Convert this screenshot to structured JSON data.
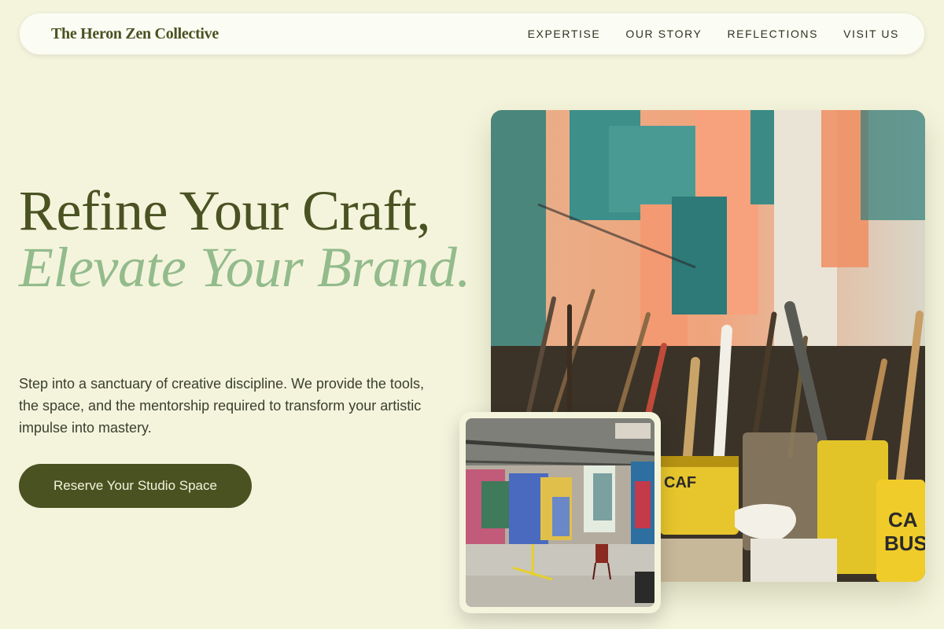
{
  "header": {
    "brand": "The Heron Zen Collective",
    "nav": [
      {
        "label": "EXPERTISE"
      },
      {
        "label": "OUR STORY"
      },
      {
        "label": "REFLECTIONS"
      },
      {
        "label": "VISIT US"
      }
    ]
  },
  "hero": {
    "title_line1": "Refine Your Craft,",
    "title_line2": "Elevate Your Brand.",
    "description": "Step into a sanctuary of creative discipline. We provide the tools, the space, and the mentorship required to transform your artistic impulse into mastery.",
    "cta_label": "Reserve Your Studio Space"
  },
  "images": {
    "main": "paint-brushes-in-cans-photo",
    "inset": "graffiti-art-studio-photo"
  },
  "colors": {
    "background": "#f4f4dc",
    "brand_olive": "#4a5222",
    "accent_sage": "#93bb8c"
  }
}
